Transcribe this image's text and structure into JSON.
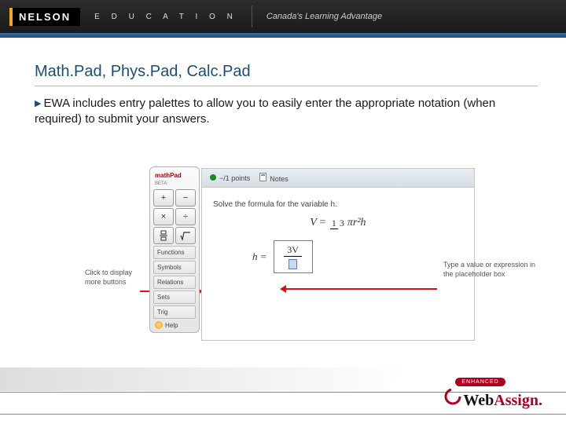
{
  "header": {
    "brand": "NELSON",
    "edu": "E D U C A T I O N",
    "tagline": "Canada's Learning Advantage"
  },
  "title": "Math.Pad, Phys.Pad, Calc.Pad",
  "bullet": "EWA includes entry palettes to allow you to easily enter the appropriate notation (when required) to submit your answers.",
  "mathpad": {
    "name": "mathPad",
    "beta": "BETA",
    "buttons": {
      "plus": "+",
      "minus": "−",
      "times": "×",
      "divide": "÷"
    },
    "categories": [
      "Functions",
      "Symbols",
      "Relations",
      "Sets",
      "Trig"
    ],
    "help": "Help"
  },
  "workarea": {
    "points": "−/1 points",
    "notes": "Notes",
    "prompt": "Solve the formula for the variable h.",
    "formula": {
      "lhs": "V",
      "eq": "=",
      "fracN": "1",
      "fracD": "3",
      "rhs": "πr²h"
    },
    "answer": {
      "label": "h =",
      "numerator": "3V"
    }
  },
  "callouts": {
    "left": "Click to display more buttons",
    "right": "Type a value or expression in the placeholder box"
  },
  "logo": {
    "enhanced": "ENHANCED",
    "web": "Web",
    "assign": "Assign."
  }
}
